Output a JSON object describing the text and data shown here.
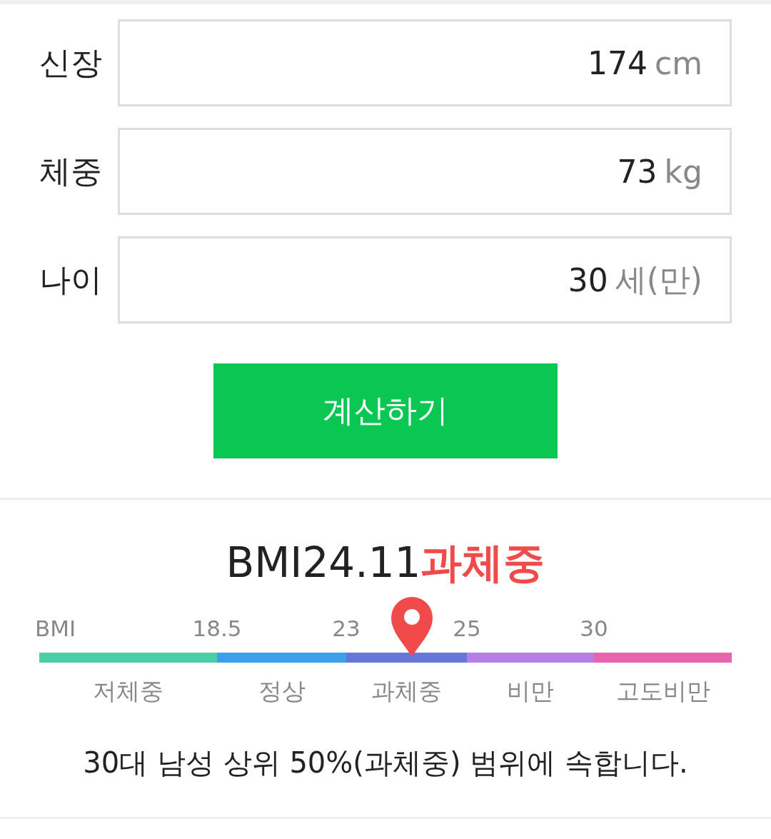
{
  "fields": [
    {
      "label": "신장",
      "value": "174",
      "unit": "cm"
    },
    {
      "label": "체중",
      "value": "73",
      "unit": "kg"
    },
    {
      "label": "나이",
      "value": "30",
      "unit": "세(만)"
    }
  ],
  "button": "계산하기",
  "result": {
    "prefix": "BMI",
    "value": "24.11",
    "category": "과체중"
  },
  "scale": {
    "ticks": [
      "BMI",
      "18.5",
      "23",
      "25",
      "30"
    ],
    "segments": [
      {
        "label": "저체중",
        "color": "#4ccfa8"
      },
      {
        "label": "정상",
        "color": "#3aa0ea"
      },
      {
        "label": "과체중",
        "color": "#6676d9"
      },
      {
        "label": "비만",
        "color": "#b57de6"
      },
      {
        "label": "고도비만",
        "color": "#e763ae"
      }
    ]
  },
  "summary": "30대 남성 상위 50%(과체중) 범위에 속합니다."
}
